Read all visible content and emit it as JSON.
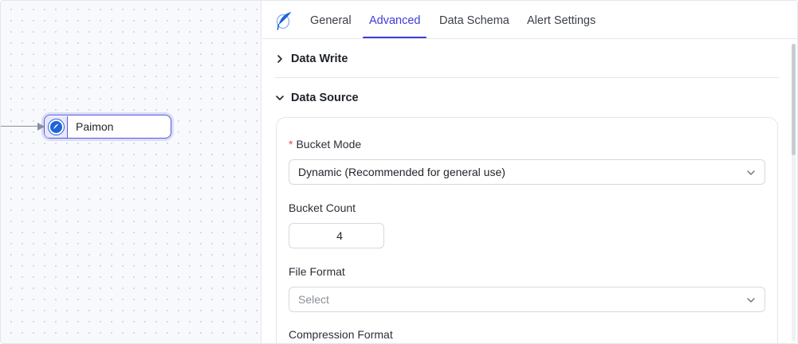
{
  "canvas": {
    "node": {
      "label": "Paimon",
      "icon": "paimon-logo-icon"
    }
  },
  "panel": {
    "logo_icon": "paimon-logo-icon",
    "tabs": [
      {
        "label": "General",
        "active": false
      },
      {
        "label": "Advanced",
        "active": true
      },
      {
        "label": "Data Schema",
        "active": false
      },
      {
        "label": "Alert Settings",
        "active": false
      }
    ],
    "sections": {
      "data_write": {
        "title": "Data Write",
        "expanded": false,
        "icon": "chevron-right-icon"
      },
      "data_source": {
        "title": "Data Source",
        "expanded": true,
        "icon": "chevron-down-icon"
      }
    },
    "fields": {
      "bucket_mode": {
        "label": "Bucket Mode",
        "required_mark": "*",
        "value": "Dynamic (Recommended for general use)"
      },
      "bucket_count": {
        "label": "Bucket Count",
        "value": "4"
      },
      "file_format": {
        "label": "File Format",
        "placeholder": "Select"
      },
      "compression_format": {
        "label": "Compression Format"
      }
    }
  },
  "colors": {
    "accent": "#3f3cd6",
    "node_border": "#5b57e0",
    "required": "#e5484d",
    "logo_blue": "#1e63d8"
  }
}
